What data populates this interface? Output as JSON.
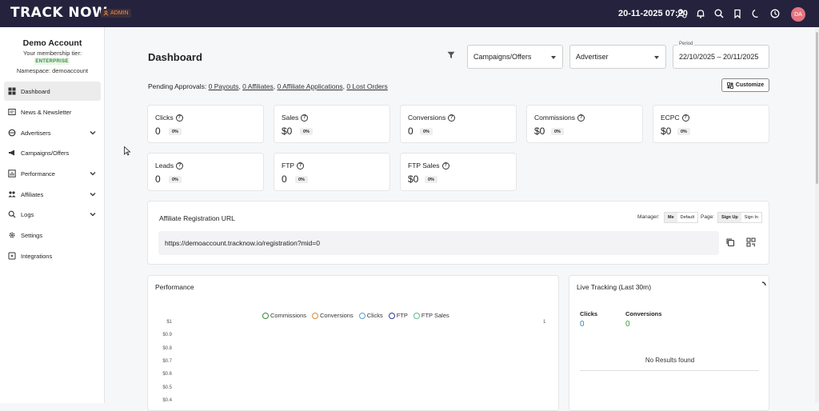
{
  "topbar": {
    "logo": "TRACK NOW",
    "role_badge": "ADMIN",
    "datetime": "20-11-2025 07:20",
    "avatar_initials": "DA"
  },
  "sidebar": {
    "account_name": "Demo Account",
    "tier_label": "Your membership tier:",
    "tier": "ENTERPRISE",
    "namespace": "Namespace: demoaccount",
    "items": [
      {
        "label": "Dashboard",
        "icon": "dashboard-icon",
        "active": true
      },
      {
        "label": "News & Newsletter",
        "icon": "newsletter-icon"
      },
      {
        "label": "Advertisers",
        "icon": "advertisers-icon",
        "expandable": true
      },
      {
        "label": "Campaigns/Offers",
        "icon": "megaphone-icon"
      },
      {
        "label": "Performance",
        "icon": "chart-icon",
        "expandable": true
      },
      {
        "label": "Affiliates",
        "icon": "affiliates-icon",
        "expandable": true
      },
      {
        "label": "Logs",
        "icon": "logs-icon",
        "expandable": true
      },
      {
        "label": "Settings",
        "icon": "gear-icon"
      },
      {
        "label": "Integrations",
        "icon": "integrations-icon"
      }
    ]
  },
  "main": {
    "title": "Dashboard",
    "filters": {
      "campaigns": "Campaigns/Offers",
      "advertiser": "Advertiser",
      "period_label": "Period",
      "period_value": "22/10/2025 – 20/11/2025"
    },
    "pending": {
      "prefix": "Pending Approvals:",
      "payouts": "0 Payouts",
      "affiliates": "0 Affiliates",
      "applications": "0 Affiliate Applications",
      "lost_orders": "0 Lost Orders"
    },
    "customize_label": "Customize",
    "stats": [
      {
        "label": "Clicks",
        "value": "0",
        "change": "0%"
      },
      {
        "label": "Sales",
        "value": "$0",
        "change": "0%"
      },
      {
        "label": "Conversions",
        "value": "0",
        "change": "0%"
      },
      {
        "label": "Commissions",
        "value": "$0",
        "change": "0%"
      },
      {
        "label": "ECPC",
        "value": "$0",
        "change": "0%"
      },
      {
        "label": "Leads",
        "value": "0",
        "change": "0%"
      },
      {
        "label": "FTP",
        "value": "0",
        "change": "0%"
      },
      {
        "label": "FTP Sales",
        "value": "$0",
        "change": "0%"
      }
    ],
    "registration": {
      "title": "Affiliate Registration URL",
      "manager_label": "Manager:",
      "manager_options": [
        "Me",
        "Default"
      ],
      "page_label": "Page:",
      "page_options": [
        "Sign Up",
        "Sign In"
      ],
      "url": "https://demoaccount.tracknow.io/registration?mid=0"
    },
    "performance": {
      "title": "Performance",
      "legend": [
        {
          "name": "Commissions",
          "color": "#3a8a3a"
        },
        {
          "name": "Conversions",
          "color": "#e08a3c"
        },
        {
          "name": "Clicks",
          "color": "#5aa0c8"
        },
        {
          "name": "FTP",
          "color": "#2e3e8c"
        },
        {
          "name": "FTP Sales",
          "color": "#5bbf8a"
        }
      ],
      "yticks": [
        "$1",
        "$0.9",
        "$0.8",
        "$0.7",
        "$0.6",
        "$0.5",
        "$0.4"
      ],
      "y2_tick": "1"
    },
    "live": {
      "title": "Live Tracking (Last 30m)",
      "clicks_label": "Clicks",
      "clicks_value": "0",
      "conversions_label": "Conversions",
      "conversions_value": "0",
      "empty": "No Results found"
    }
  }
}
